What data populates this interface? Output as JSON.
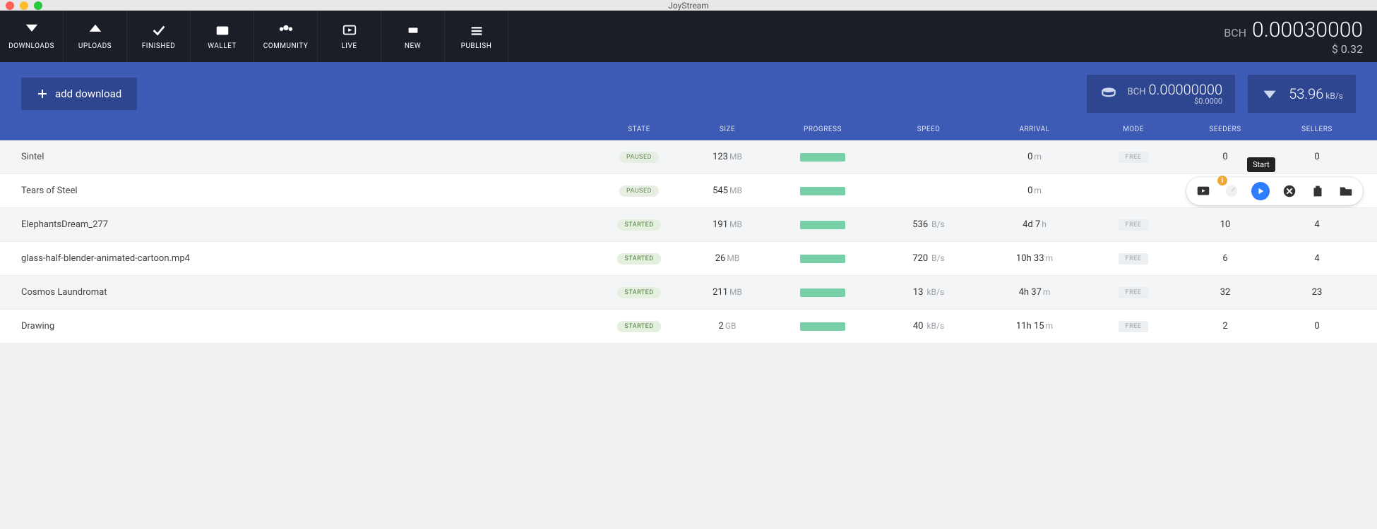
{
  "app_title": "JoyStream",
  "nav": {
    "tabs": [
      {
        "id": "downloads",
        "label": "DOWNLOADS"
      },
      {
        "id": "uploads",
        "label": "UPLOADS"
      },
      {
        "id": "finished",
        "label": "FINISHED"
      },
      {
        "id": "wallet",
        "label": "WALLET"
      },
      {
        "id": "community",
        "label": "COMMUNITY"
      },
      {
        "id": "live",
        "label": "LIVE"
      },
      {
        "id": "new",
        "label": "NEW"
      },
      {
        "id": "publish",
        "label": "PUBLISH"
      }
    ],
    "balance": {
      "prefix": "BCH",
      "amount": "0.00030000",
      "usd": "$ 0.32"
    }
  },
  "subheader": {
    "add_button": "add download",
    "pending": {
      "prefix": "BCH",
      "amount": "0.00000000",
      "usd": "$0.0000"
    },
    "speed": {
      "value": "53.96",
      "unit": "kB/s"
    }
  },
  "columns": [
    "",
    "STATE",
    "SIZE",
    "PROGRESS",
    "SPEED",
    "ARRIVAL",
    "MODE",
    "SEEDERS",
    "SELLERS"
  ],
  "tooltip_start": "Start",
  "rows": [
    {
      "name": "Sintel",
      "state": "PAUSED",
      "size_v": "123",
      "size_u": "MB",
      "speed_v": "",
      "speed_u": "",
      "arrival_v": "0",
      "arrival_u": "m",
      "mode": "FREE",
      "seeders": "0",
      "sellers": "0",
      "actions": false
    },
    {
      "name": "Tears of Steel",
      "state": "PAUSED",
      "size_v": "545",
      "size_u": "MB",
      "speed_v": "",
      "speed_u": "",
      "arrival_v": "0",
      "arrival_u": "m",
      "mode": "",
      "seeders": "",
      "sellers": "",
      "actions": true
    },
    {
      "name": "ElephantsDream_277",
      "state": "STARTED",
      "size_v": "191",
      "size_u": "MB",
      "speed_v": "536",
      "speed_u": "B/s",
      "arrival_v": "4d 7",
      "arrival_u": "h",
      "mode": "FREE",
      "seeders": "10",
      "sellers": "4",
      "actions": false
    },
    {
      "name": "glass-half-blender-animated-cartoon.mp4",
      "state": "STARTED",
      "size_v": "26",
      "size_u": "MB",
      "speed_v": "720",
      "speed_u": "B/s",
      "arrival_v": "10h 33",
      "arrival_u": "m",
      "mode": "FREE",
      "seeders": "6",
      "sellers": "4",
      "actions": false
    },
    {
      "name": "Cosmos Laundromat",
      "state": "STARTED",
      "size_v": "211",
      "size_u": "MB",
      "speed_v": "13",
      "speed_u": "kB/s",
      "arrival_v": "4h 37",
      "arrival_u": "m",
      "mode": "FREE",
      "seeders": "32",
      "sellers": "23",
      "actions": false
    },
    {
      "name": "Drawing",
      "state": "STARTED",
      "size_v": "2",
      "size_u": "GB",
      "speed_v": "40",
      "speed_u": "kB/s",
      "arrival_v": "11h 15",
      "arrival_u": "m",
      "mode": "FREE",
      "seeders": "2",
      "sellers": "0",
      "actions": false
    }
  ]
}
